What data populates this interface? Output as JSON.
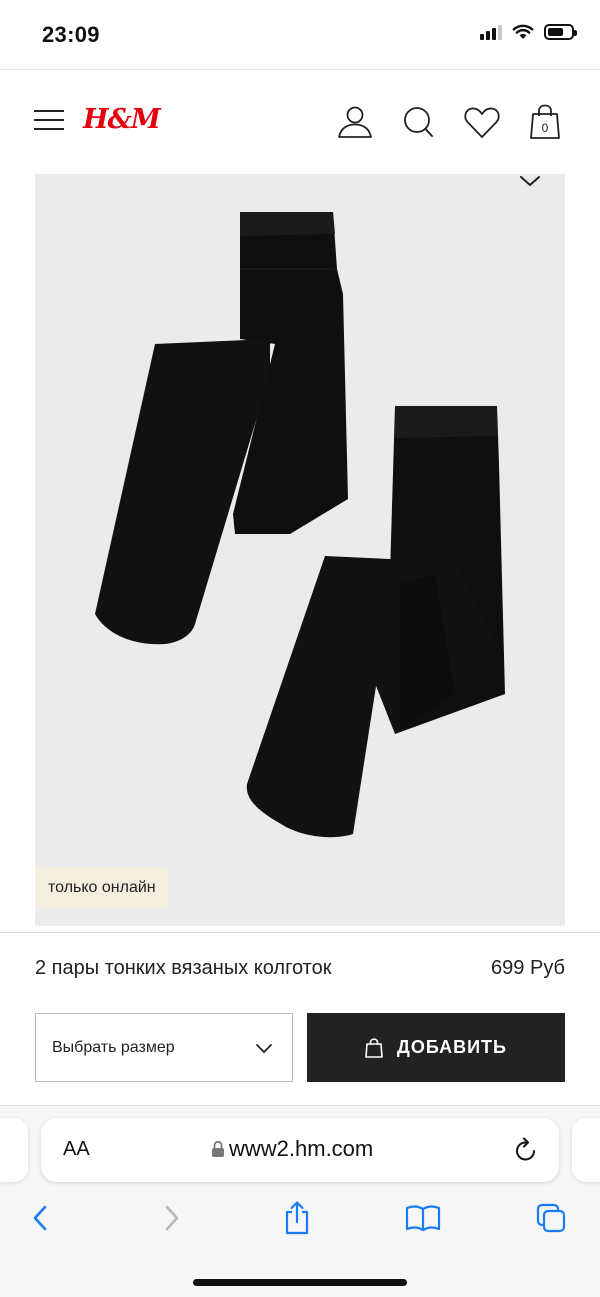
{
  "status_bar": {
    "time": "23:09",
    "icons": [
      "signal-icon",
      "wifi-icon",
      "battery-icon"
    ]
  },
  "header": {
    "logo": "H&M",
    "icons": [
      "menu-icon",
      "account-icon",
      "search-icon",
      "favorites-icon",
      "bag-icon"
    ],
    "bag_count": "0"
  },
  "product": {
    "badge": "только онлайн",
    "name": "2 пары тонких вязаных колготок",
    "price": "699 Руб",
    "size_select": {
      "label": "Выбрать размер"
    },
    "add_button": "ДОБАВИТЬ"
  },
  "browser": {
    "aa_label": "AA",
    "url": "www2.hm.com",
    "toolbar_icons": [
      "back-icon",
      "forward-icon",
      "share-icon",
      "bookmarks-icon",
      "tabs-icon"
    ]
  },
  "colors": {
    "brand_red": "#e50010",
    "badge_bg": "#f4eedf",
    "button_bg": "#222222",
    "ios_blue": "#1a7cf5"
  }
}
